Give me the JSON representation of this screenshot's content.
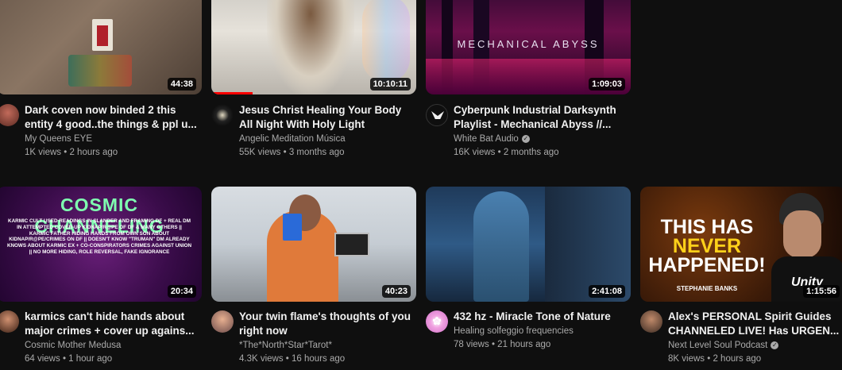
{
  "videos": [
    {
      "title": "Dark coven now binded 2 this entity 4 good..the things & ppl u...",
      "channel": "My Queens EYE",
      "views": "1K views",
      "age": "2 hours ago",
      "duration": "44:38",
      "verified": false
    },
    {
      "title": "Jesus Christ Healing Your Body All Night With Holy Light",
      "channel": "Angelic Meditation Música",
      "views": "55K views",
      "age": "3 months ago",
      "duration": "10:10:11",
      "watched_fraction": 0.2,
      "verified": false
    },
    {
      "title": "Cyberpunk Industrial Darksynth Playlist - Mechanical Abyss //...",
      "channel": "White Bat Audio",
      "views": "16K views",
      "age": "2 months ago",
      "duration": "1:09:03",
      "thumb_text": "MECHANICAL ABYSS",
      "verified": true
    },
    {
      "title": "karmics can't hide hands about major crimes + cover up agains...",
      "channel": "Cosmic Mother Medusa",
      "views": "64 views",
      "age": "1 hour ago",
      "duration": "20:34",
      "thumb_title": "COSMIC CHANNELING",
      "thumb_text": "KARMIC CULT USED READINGS IN SLANDER AND FRAMING DF + REAL DM IN ATTEMPTED COVER-UP KIDNAP/R@PE OF DF & MANY OTHERS || KARMIC FATHER HIDING HANDS FROM OWN SON ABOUT KIDNAP/R@PE/CRIMES ON DF || DOESN'T KNOW \"TRUMAN\" DM ALREADY KNOWS ABOUT KARMIC EX + CO-CONSPIRATORS CRIMES AGAINST UNION || NO MORE HIDING, ROLE REVERSAL, FAKE IGNORANCE",
      "verified": false
    },
    {
      "title": "Your twin flame's thoughts of you right now",
      "channel": "*The*North*Star*Tarot*",
      "views": "4.3K views",
      "age": "16 hours ago",
      "duration": "40:23",
      "verified": false
    },
    {
      "title": "432 hz - Miracle Tone of Nature",
      "channel": "Healing solfeggio frequencies",
      "views": "78 views",
      "age": "21 hours ago",
      "duration": "2:41:08",
      "verified": false
    },
    {
      "title": "Alex's PERSONAL Spirit Guides CHANNELED LIVE! Has URGEN...",
      "channel": "Next Level Soul Podcast",
      "views": "8K views",
      "age": "2 hours ago",
      "duration": "1:15:56",
      "thumb_line1": "THIS HAS",
      "thumb_line2": "NEVER",
      "thumb_line3": "HAPPENED!",
      "thumb_sub": "STEPHANIE BANKS",
      "thumb_shirt": "Unity",
      "verified": true
    }
  ],
  "separator": " • ",
  "colors": {
    "background": "#0f0f0f",
    "text_primary": "#f1f1f1",
    "text_secondary": "#aaaaaa",
    "progress": "#ff0000"
  }
}
